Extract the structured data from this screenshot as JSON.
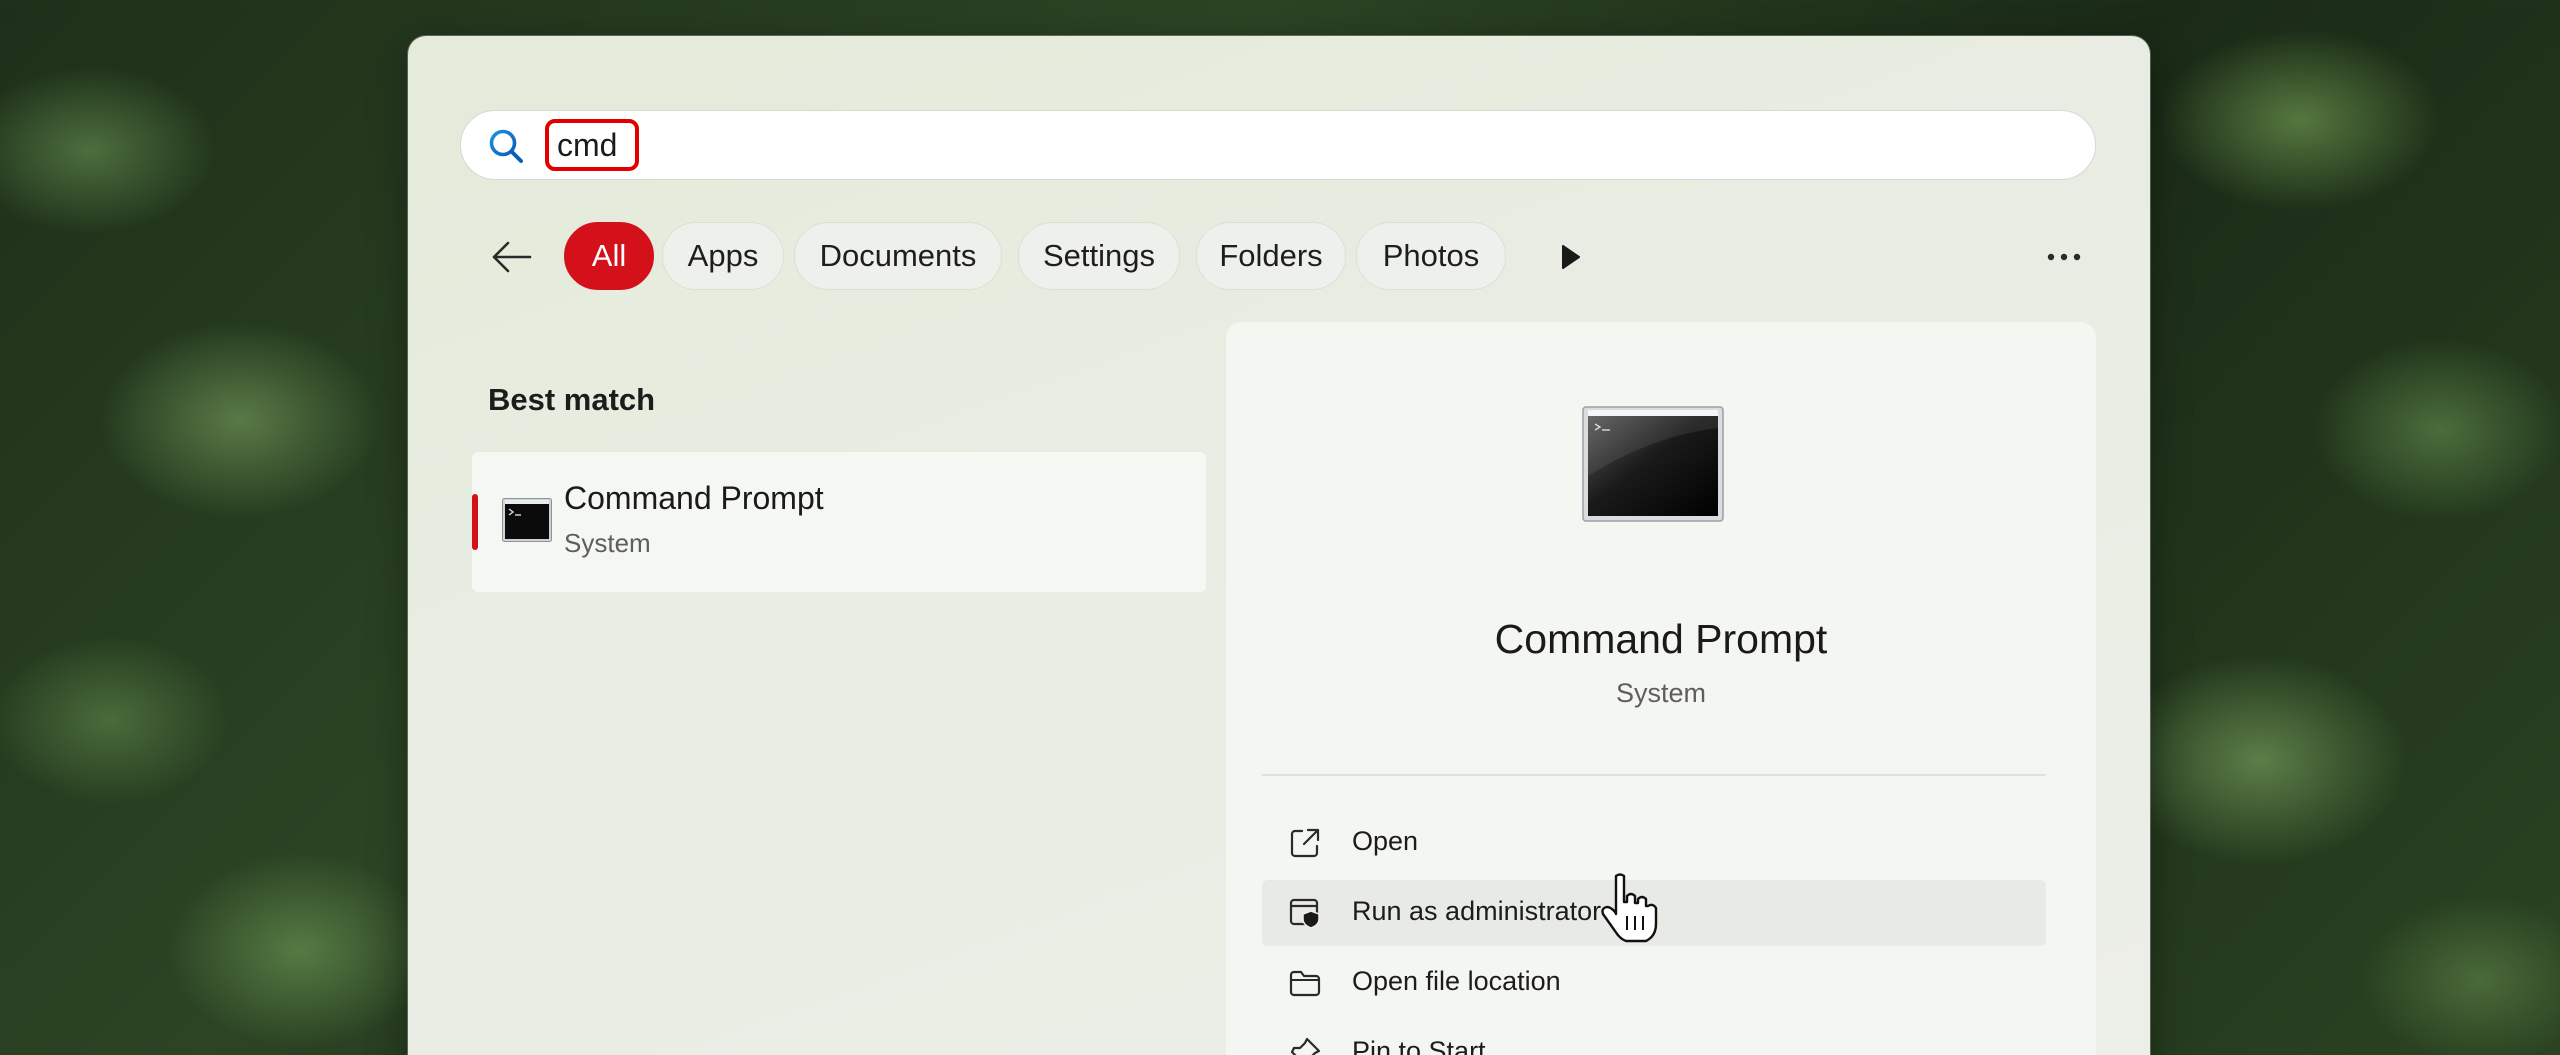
{
  "search": {
    "value": "cmd",
    "highlight_color": "#e00000"
  },
  "filters": {
    "items": [
      {
        "label": "All",
        "active": true
      },
      {
        "label": "Apps",
        "active": false
      },
      {
        "label": "Documents",
        "active": false
      },
      {
        "label": "Settings",
        "active": false
      },
      {
        "label": "Folders",
        "active": false
      },
      {
        "label": "Photos",
        "active": false
      }
    ],
    "accent_color": "#d4111b"
  },
  "results": {
    "heading": "Best match",
    "best_match": {
      "title": "Command Prompt",
      "subtitle": "System",
      "icon": "command-prompt-icon"
    }
  },
  "preview": {
    "title": "Command Prompt",
    "subtitle": "System",
    "icon": "command-prompt-icon",
    "actions": [
      {
        "label": "Open",
        "icon": "open-external-icon"
      },
      {
        "label": "Run as administrator",
        "icon": "shield-window-icon",
        "hovered": true
      },
      {
        "label": "Open file location",
        "icon": "folder-icon"
      },
      {
        "label": "Pin to Start",
        "icon": "pin-icon"
      }
    ]
  }
}
